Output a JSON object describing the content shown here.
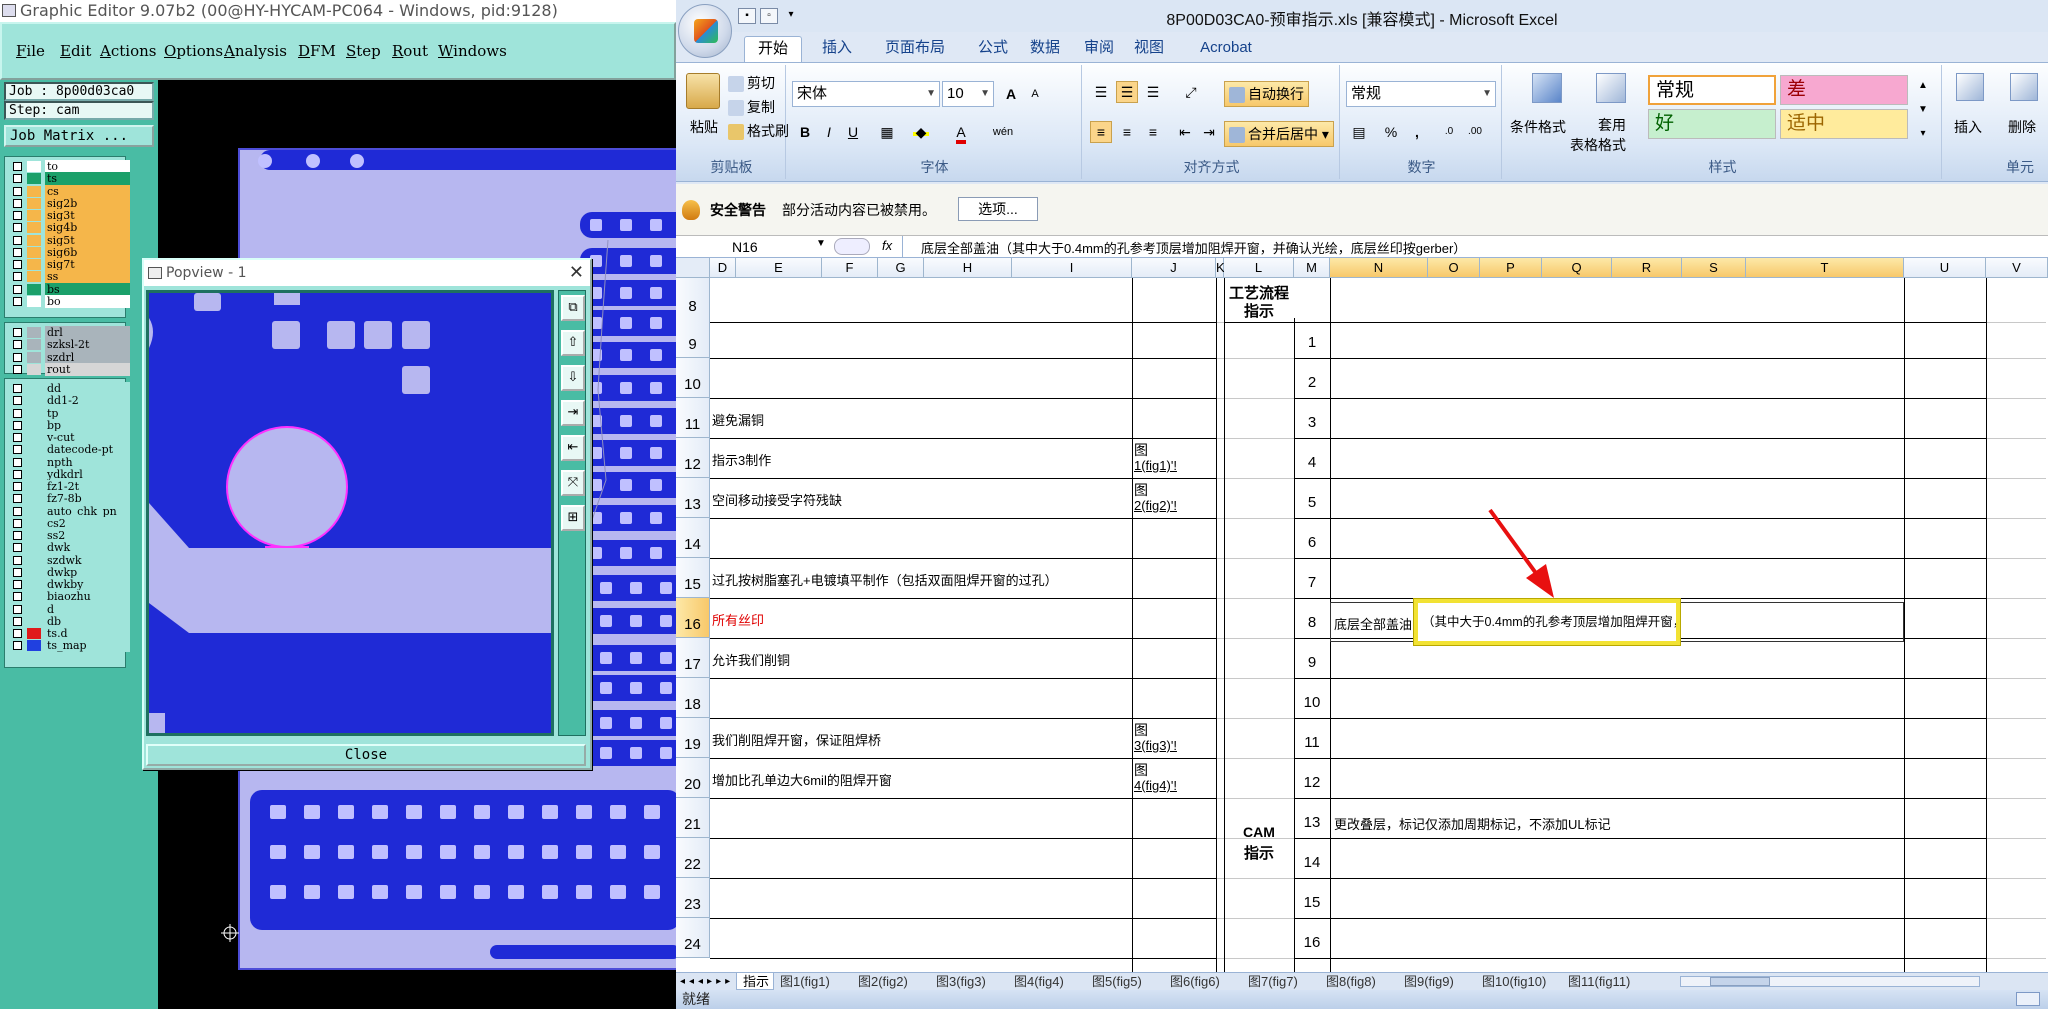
{
  "graphic_editor": {
    "title": "Graphic Editor 9.07b2 (00@HY-HYCAM-PC064 - Windows, pid:9128)",
    "menu": [
      {
        "u": "F",
        "rest": "ile"
      },
      {
        "u": "E",
        "rest": "dit"
      },
      {
        "u": "A",
        "rest": "ctions"
      },
      {
        "u": "O",
        "rest": "ptions"
      },
      {
        "u": "A",
        "rest": "nalysis"
      },
      {
        "u": "D",
        "rest": "FM"
      },
      {
        "u": "S",
        "rest": "tep"
      },
      {
        "u": "R",
        "rest": "out"
      },
      {
        "u": "W",
        "rest": "indows"
      }
    ],
    "job_label": "Job : 8p00d03ca0",
    "step_label": "Step: cam",
    "job_matrix_button": "Job Matrix ...",
    "layers_group1": [
      {
        "name": "to",
        "color": "#ffffff",
        "bg": "#ffffff"
      },
      {
        "name": "ts",
        "color": "#1ba06a",
        "bg": "#1ba06a"
      },
      {
        "name": "cs",
        "color": "#f5b64a",
        "bg": "#f5b64a"
      },
      {
        "name": "sig2b",
        "color": "#f5b64a",
        "bg": "#f5b64a"
      },
      {
        "name": "sig3t",
        "color": "#f5b64a",
        "bg": "#f5b64a"
      },
      {
        "name": "sig4b",
        "color": "#f5b64a",
        "bg": "#f5b64a"
      },
      {
        "name": "sig5t",
        "color": "#f5b64a",
        "bg": "#f5b64a"
      },
      {
        "name": "sig6b",
        "color": "#f5b64a",
        "bg": "#f5b64a"
      },
      {
        "name": "sig7t",
        "color": "#f5b64a",
        "bg": "#f5b64a"
      },
      {
        "name": "ss",
        "color": "#f5b64a",
        "bg": "#f5b64a"
      },
      {
        "name": "bs",
        "color": "#1ba06a",
        "bg": "#1ba06a"
      },
      {
        "name": "bo",
        "color": "#ffffff",
        "bg": "#ffffff"
      }
    ],
    "layers_group2": [
      {
        "name": "drl",
        "color": "#a9b4bb",
        "bg": "#a9b4bb"
      },
      {
        "name": "szksl-2t",
        "color": "#a9b4bb",
        "bg": "#a9b4bb"
      },
      {
        "name": "szdrl",
        "color": "#a9b4bb",
        "bg": "#a9b4bb"
      },
      {
        "name": "rout",
        "color": "#d6d6d6",
        "bg": "#d6d6d6"
      }
    ],
    "layers_group3": [
      {
        "name": "dd",
        "color": "#9fe4da",
        "bg": "#9fe4da"
      },
      {
        "name": "dd1-2",
        "color": "#9fe4da",
        "bg": "#9fe4da"
      },
      {
        "name": "tp",
        "color": "#9fe4da",
        "bg": "#9fe4da"
      },
      {
        "name": "bp",
        "color": "#9fe4da",
        "bg": "#9fe4da"
      },
      {
        "name": "v-cut",
        "color": "#9fe4da",
        "bg": "#9fe4da"
      },
      {
        "name": "datecode-pt",
        "color": "#9fe4da",
        "bg": "#9fe4da"
      },
      {
        "name": "npth",
        "color": "#9fe4da",
        "bg": "#9fe4da"
      },
      {
        "name": "ydkdrl",
        "color": "#9fe4da",
        "bg": "#9fe4da"
      },
      {
        "name": "fz1-2t",
        "color": "#9fe4da",
        "bg": "#9fe4da"
      },
      {
        "name": "fz7-8b",
        "color": "#9fe4da",
        "bg": "#9fe4da"
      },
      {
        "name": "auto_chk_pn",
        "color": "#9fe4da",
        "bg": "#9fe4da"
      },
      {
        "name": "cs2",
        "color": "#9fe4da",
        "bg": "#9fe4da"
      },
      {
        "name": "ss2",
        "color": "#9fe4da",
        "bg": "#9fe4da"
      },
      {
        "name": "dwk",
        "color": "#9fe4da",
        "bg": "#9fe4da"
      },
      {
        "name": "szdwk",
        "color": "#9fe4da",
        "bg": "#9fe4da"
      },
      {
        "name": "dwkp",
        "color": "#9fe4da",
        "bg": "#9fe4da"
      },
      {
        "name": "dwkby",
        "color": "#9fe4da",
        "bg": "#9fe4da"
      },
      {
        "name": "biaozhu",
        "color": "#9fe4da",
        "bg": "#9fe4da"
      },
      {
        "name": "d",
        "color": "#9fe4da",
        "bg": "#9fe4da"
      },
      {
        "name": "db",
        "color": "#9fe4da",
        "bg": "#9fe4da"
      },
      {
        "name": "ts.d",
        "color": "#e01a1a",
        "bg": "#9fe4da"
      },
      {
        "name": "ts_map",
        "color": "#2040e0",
        "bg": "#9fe4da"
      }
    ],
    "colors": {
      "board": "#b7b7f0",
      "copper": "#1f2ad6",
      "panel": "#9fe4da",
      "highlight": "#ff30ff"
    }
  },
  "popview": {
    "title": "Popview - 1",
    "close_glyph": "✕",
    "close_button": "Close",
    "tools": [
      "⧉",
      "⇧",
      "⇩",
      "⇥",
      "⇤",
      "⤧",
      "⊞"
    ]
  },
  "excel": {
    "title": "8P00D03CA0-预审指示.xls  [兼容模式] - Microsoft Excel",
    "tabs": [
      "开始",
      "插入",
      "页面布局",
      "公式",
      "数据",
      "审阅",
      "视图",
      "Acrobat"
    ],
    "clipboard": {
      "paste": "粘贴",
      "cut": "剪切",
      "copy": "复制",
      "format_painter": "格式刷",
      "label": "剪贴板"
    },
    "font": {
      "name": "宋体",
      "size": "10",
      "label": "字体",
      "bold": "B",
      "italic": "I",
      "underline": "U",
      "grow": "A",
      "shrink": "A",
      "fontcolor": "A",
      "phonetic": "wén"
    },
    "alignment": {
      "wrap": "自动换行",
      "merge": "合并后居中",
      "label": "对齐方式"
    },
    "number": {
      "format": "常规",
      "percent": "%",
      "comma": ",",
      "label": "数字"
    },
    "styles": {
      "conditional": "条件格式",
      "table_fmt_1": "套用",
      "table_fmt_2": "表格格式",
      "normal": "常规",
      "bad": "差",
      "good": "好",
      "neutral": "适中",
      "label": "样式"
    },
    "cells": {
      "insert": "插入",
      "delete": "删除",
      "label": "单元"
    },
    "security": {
      "title": "安全警告",
      "message": "部分活动内容已被禁用。",
      "options_button": "选项..."
    },
    "formula_bar": {
      "name_box": "N16",
      "fx": "fx",
      "content": "底层全部盖油（其中大于0.4mm的孔参考顶层增加阻焊开窗，并确认光绘，底层丝印按gerber）"
    },
    "columns": [
      "D",
      "E",
      "F",
      "G",
      "H",
      "I",
      "J",
      "K",
      "L",
      "M",
      "N",
      "O",
      "P",
      "Q",
      "R",
      "S",
      "T",
      "U",
      "V"
    ],
    "rows": [
      "8",
      "9",
      "10",
      "11",
      "12",
      "13",
      "14",
      "15",
      "16",
      "17",
      "18",
      "19",
      "20",
      "21",
      "22",
      "23",
      "24"
    ],
    "left_cells": [
      {
        "row": "11",
        "text": "避免漏铜",
        "color": "#000"
      },
      {
        "row": "12",
        "text": "指示3制作",
        "color": "#000"
      },
      {
        "row": "13",
        "text": "空间移动接受字符残缺",
        "color": "#000"
      },
      {
        "row": "15",
        "text": "过孔按树脂塞孔+电镀填平制作（包括双面阻焊开窗的过孔）",
        "color": "#000"
      },
      {
        "row": "16",
        "text": "所有丝印",
        "color": "#e00000"
      },
      {
        "row": "17",
        "text": "允许我们削铜",
        "color": "#000"
      },
      {
        "row": "19",
        "text": "我们削阻焊开窗，保证阻焊桥",
        "color": "#000"
      },
      {
        "row": "20",
        "text": "增加比孔单边大6mil的阻焊开窗",
        "color": "#000"
      }
    ],
    "fig_refs": [
      {
        "row": "12",
        "line1": "图",
        "line2": "1(fig1)'!"
      },
      {
        "row": "13",
        "line1": "图",
        "line2": "2(fig2)'!"
      },
      {
        "row": "19",
        "line1": "图",
        "line2": "3(fig3)'!"
      },
      {
        "row": "20",
        "line1": "图",
        "line2": "4(fig4)'!"
      }
    ],
    "process_header_1": "工艺流程",
    "process_header_2": "指示",
    "cam_label_1": "CAM",
    "cam_label_2": "指示",
    "step_numbers": [
      "1",
      "2",
      "3",
      "4",
      "5",
      "6",
      "7",
      "8",
      "9",
      "10",
      "11",
      "12",
      "13",
      "14",
      "15",
      "16"
    ],
    "step8_prefix": "底层全部盖油",
    "step8_text": "（其中大于0.4mm的孔参考顶层增加阻焊开窗，并确认光绘，底层丝印按gerber）",
    "step13_text": "更改叠层，标记仅添加周期标记，不添加UL标记",
    "sheet_tabs": [
      "指示",
      "图1(fig1)",
      "图2(fig2)",
      "图3(fig3)",
      "图4(fig4)",
      "图5(fig5)",
      "图6(fig6)",
      "图7(fig7)",
      "图8(fig8)",
      "图9(fig9)",
      "图10(fig10)",
      "图11(fig11)"
    ],
    "status": "就绪"
  }
}
